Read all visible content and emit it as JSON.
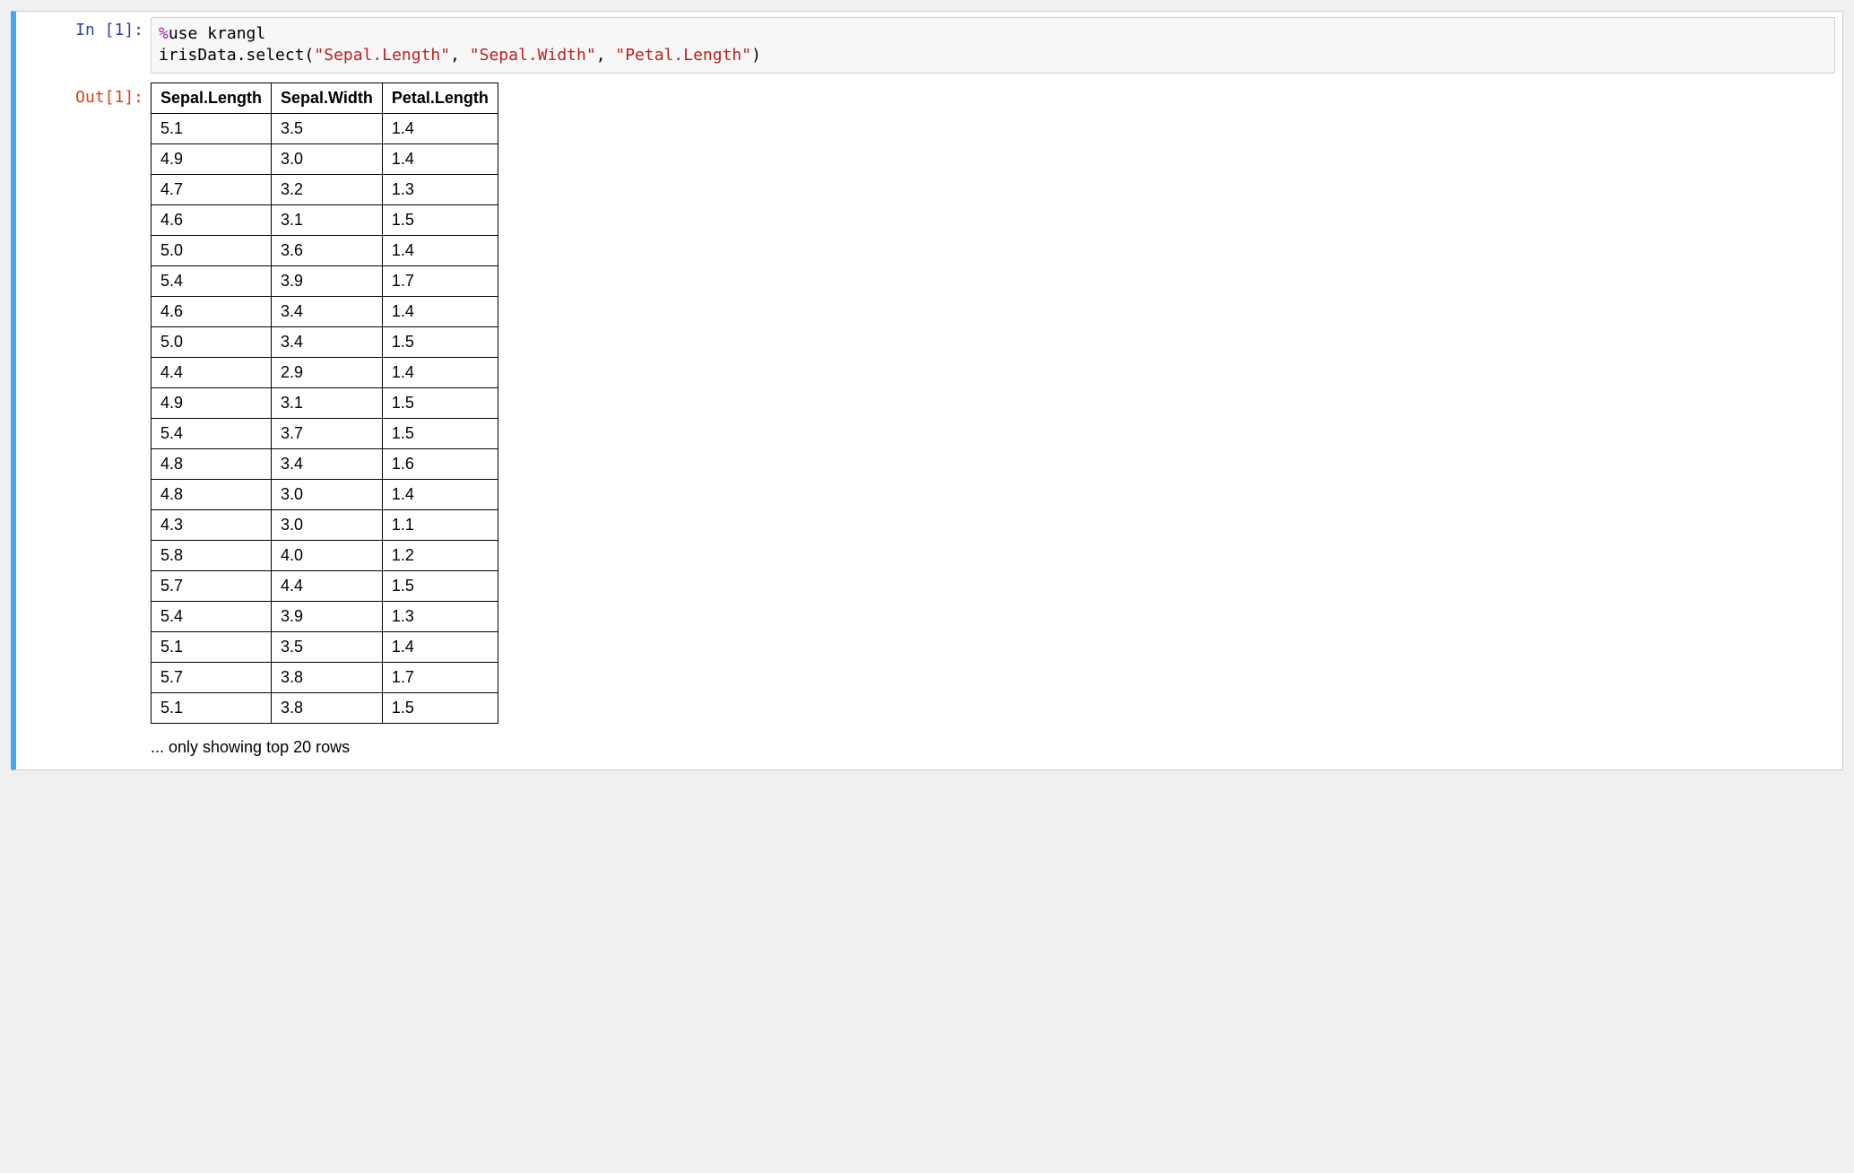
{
  "cell": {
    "in_prompt": "In [1]:",
    "out_prompt": "Out[1]:",
    "code_tokens": [
      {
        "cls": "tok-magic-pct",
        "text": "%"
      },
      {
        "cls": "tok-default",
        "text": "use krangl\nirisData.select("
      },
      {
        "cls": "tok-str",
        "text": "\"Sepal.Length\""
      },
      {
        "cls": "tok-default",
        "text": ", "
      },
      {
        "cls": "tok-str",
        "text": "\"Sepal.Width\""
      },
      {
        "cls": "tok-default",
        "text": ", "
      },
      {
        "cls": "tok-str",
        "text": "\"Petal.Length\""
      },
      {
        "cls": "tok-default",
        "text": ")"
      }
    ],
    "output": {
      "columns": [
        "Sepal.Length",
        "Sepal.Width",
        "Petal.Length"
      ],
      "rows": [
        [
          "5.1",
          "3.5",
          "1.4"
        ],
        [
          "4.9",
          "3.0",
          "1.4"
        ],
        [
          "4.7",
          "3.2",
          "1.3"
        ],
        [
          "4.6",
          "3.1",
          "1.5"
        ],
        [
          "5.0",
          "3.6",
          "1.4"
        ],
        [
          "5.4",
          "3.9",
          "1.7"
        ],
        [
          "4.6",
          "3.4",
          "1.4"
        ],
        [
          "5.0",
          "3.4",
          "1.5"
        ],
        [
          "4.4",
          "2.9",
          "1.4"
        ],
        [
          "4.9",
          "3.1",
          "1.5"
        ],
        [
          "5.4",
          "3.7",
          "1.5"
        ],
        [
          "4.8",
          "3.4",
          "1.6"
        ],
        [
          "4.8",
          "3.0",
          "1.4"
        ],
        [
          "4.3",
          "3.0",
          "1.1"
        ],
        [
          "5.8",
          "4.0",
          "1.2"
        ],
        [
          "5.7",
          "4.4",
          "1.5"
        ],
        [
          "5.4",
          "3.9",
          "1.3"
        ],
        [
          "5.1",
          "3.5",
          "1.4"
        ],
        [
          "5.7",
          "3.8",
          "1.7"
        ],
        [
          "5.1",
          "3.8",
          "1.5"
        ]
      ],
      "note": "... only showing top 20 rows"
    }
  },
  "chart_data": {
    "type": "table",
    "title": "",
    "columns": [
      "Sepal.Length",
      "Sepal.Width",
      "Petal.Length"
    ],
    "rows": [
      [
        5.1,
        3.5,
        1.4
      ],
      [
        4.9,
        3.0,
        1.4
      ],
      [
        4.7,
        3.2,
        1.3
      ],
      [
        4.6,
        3.1,
        1.5
      ],
      [
        5.0,
        3.6,
        1.4
      ],
      [
        5.4,
        3.9,
        1.7
      ],
      [
        4.6,
        3.4,
        1.4
      ],
      [
        5.0,
        3.4,
        1.5
      ],
      [
        4.4,
        2.9,
        1.4
      ],
      [
        4.9,
        3.1,
        1.5
      ],
      [
        5.4,
        3.7,
        1.5
      ],
      [
        4.8,
        3.4,
        1.6
      ],
      [
        4.8,
        3.0,
        1.4
      ],
      [
        4.3,
        3.0,
        1.1
      ],
      [
        5.8,
        4.0,
        1.2
      ],
      [
        5.7,
        4.4,
        1.5
      ],
      [
        5.4,
        3.9,
        1.3
      ],
      [
        5.1,
        3.5,
        1.4
      ],
      [
        5.7,
        3.8,
        1.7
      ],
      [
        5.1,
        3.8,
        1.5
      ]
    ],
    "note": "only showing top 20 rows"
  }
}
